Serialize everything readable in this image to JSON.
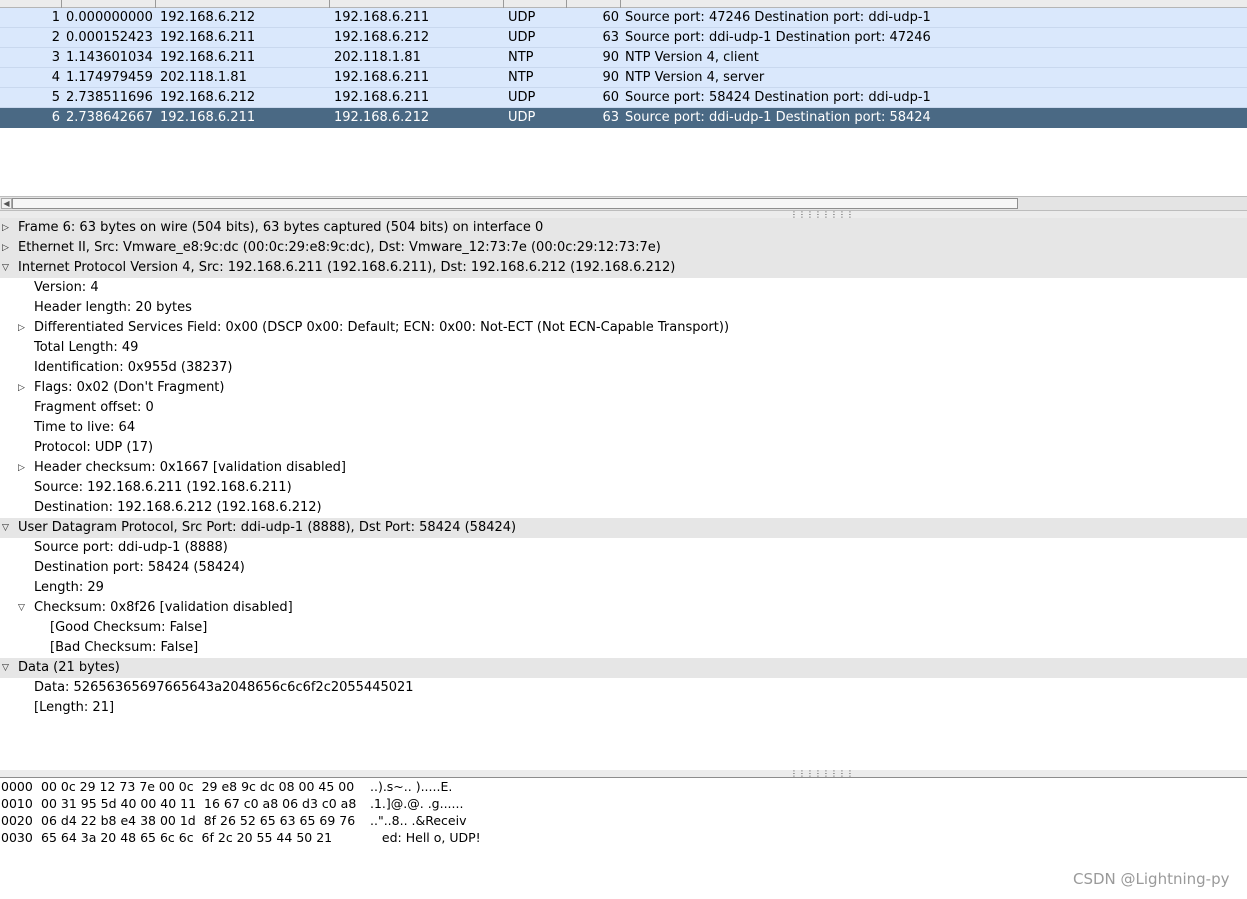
{
  "packet_list": {
    "rows": [
      {
        "no": "1",
        "time": "0.000000000",
        "source": "192.168.6.212",
        "destination": "192.168.6.211",
        "protocol": "UDP",
        "length": "60",
        "info": "Source port: 47246  Destination port: ddi-udp-1"
      },
      {
        "no": "2",
        "time": "0.000152423",
        "source": "192.168.6.211",
        "destination": "192.168.6.212",
        "protocol": "UDP",
        "length": "63",
        "info": "Source port: ddi-udp-1  Destination port: 47246"
      },
      {
        "no": "3",
        "time": "1.143601034",
        "source": "192.168.6.211",
        "destination": "202.118.1.81",
        "protocol": "NTP",
        "length": "90",
        "info": "NTP Version 4, client"
      },
      {
        "no": "4",
        "time": "1.174979459",
        "source": "202.118.1.81",
        "destination": "192.168.6.211",
        "protocol": "NTP",
        "length": "90",
        "info": "NTP Version 4, server"
      },
      {
        "no": "5",
        "time": "2.738511696",
        "source": "192.168.6.212",
        "destination": "192.168.6.211",
        "protocol": "UDP",
        "length": "60",
        "info": "Source port: 58424  Destination port: ddi-udp-1"
      },
      {
        "no": "6",
        "time": "2.738642667",
        "source": "192.168.6.211",
        "destination": "192.168.6.212",
        "protocol": "UDP",
        "length": "63",
        "info": "Source port: ddi-udp-1  Destination port: 58424"
      }
    ],
    "selected_index": 5,
    "row_colors": {
      "normal": "#dae8fc",
      "selected": "#4a6984",
      "selected_text": "#ffffff"
    }
  },
  "details": {
    "rows": [
      {
        "level": 0,
        "toggle": "collapsed",
        "text": "Frame 6: 63 bytes on wire (504 bits), 63 bytes captured (504 bits) on interface 0"
      },
      {
        "level": 0,
        "toggle": "collapsed",
        "text": "Ethernet II, Src: Vmware_e8:9c:dc (00:0c:29:e8:9c:dc), Dst: Vmware_12:73:7e (00:0c:29:12:73:7e)"
      },
      {
        "level": 0,
        "toggle": "expanded",
        "text": "Internet Protocol Version 4, Src: 192.168.6.211 (192.168.6.211), Dst: 192.168.6.212 (192.168.6.212)"
      },
      {
        "level": 1,
        "toggle": "none",
        "text": "Version: 4"
      },
      {
        "level": 1,
        "toggle": "none",
        "text": "Header length: 20 bytes"
      },
      {
        "level": 1,
        "toggle": "collapsed",
        "text": "Differentiated Services Field: 0x00 (DSCP 0x00: Default; ECN: 0x00: Not-ECT (Not ECN-Capable Transport))"
      },
      {
        "level": 1,
        "toggle": "none",
        "text": "Total Length: 49"
      },
      {
        "level": 1,
        "toggle": "none",
        "text": "Identification: 0x955d (38237)"
      },
      {
        "level": 1,
        "toggle": "collapsed",
        "text": "Flags: 0x02 (Don't Fragment)"
      },
      {
        "level": 1,
        "toggle": "none",
        "text": "Fragment offset: 0"
      },
      {
        "level": 1,
        "toggle": "none",
        "text": "Time to live: 64"
      },
      {
        "level": 1,
        "toggle": "none",
        "text": "Protocol: UDP (17)"
      },
      {
        "level": 1,
        "toggle": "collapsed",
        "text": "Header checksum: 0x1667 [validation disabled]"
      },
      {
        "level": 1,
        "toggle": "none",
        "text": "Source: 192.168.6.211 (192.168.6.211)"
      },
      {
        "level": 1,
        "toggle": "none",
        "text": "Destination: 192.168.6.212 (192.168.6.212)"
      },
      {
        "level": 0,
        "toggle": "expanded",
        "text": "User Datagram Protocol, Src Port: ddi-udp-1 (8888), Dst Port: 58424 (58424)"
      },
      {
        "level": 1,
        "toggle": "none",
        "text": "Source port: ddi-udp-1 (8888)"
      },
      {
        "level": 1,
        "toggle": "none",
        "text": "Destination port: 58424 (58424)"
      },
      {
        "level": 1,
        "toggle": "none",
        "text": "Length: 29"
      },
      {
        "level": 1,
        "toggle": "expanded",
        "text": "Checksum: 0x8f26 [validation disabled]"
      },
      {
        "level": 2,
        "toggle": "none",
        "text": "[Good Checksum: False]"
      },
      {
        "level": 2,
        "toggle": "none",
        "text": "[Bad Checksum: False]"
      },
      {
        "level": 0,
        "toggle": "expanded",
        "text": "Data (21 bytes)"
      },
      {
        "level": 1,
        "toggle": "none",
        "text": "Data: 52656365697665643a2048656c6c6f2c2055445021"
      },
      {
        "level": 1,
        "toggle": "none",
        "text": "[Length: 21]"
      }
    ]
  },
  "hex_dump": [
    {
      "offset": "0000",
      "bytes": "00 0c 29 12 73 7e 00 0c  29 e8 9c dc 08 00 45 00",
      "ascii": "..).s~.. ).....E."
    },
    {
      "offset": "0010",
      "bytes": "00 31 95 5d 40 00 40 11  16 67 c0 a8 06 d3 c0 a8",
      "ascii": ".1.]@.@. .g......"
    },
    {
      "offset": "0020",
      "bytes": "06 d4 22 b8 e4 38 00 1d  8f 26 52 65 63 65 69 76",
      "ascii": "..\"..8.. .&Receiv"
    },
    {
      "offset": "0030",
      "bytes": "65 64 3a 20 48 65 6c 6c  6f 2c 20 55 44 50 21",
      "ascii": "   ed: Hell o, UDP!"
    }
  ],
  "watermark": "CSDN @Lightning-py",
  "icons": {
    "collapsed": "triangle-right-icon",
    "expanded": "triangle-down-icon",
    "scroll_left": "scroll-left-arrow-icon"
  }
}
